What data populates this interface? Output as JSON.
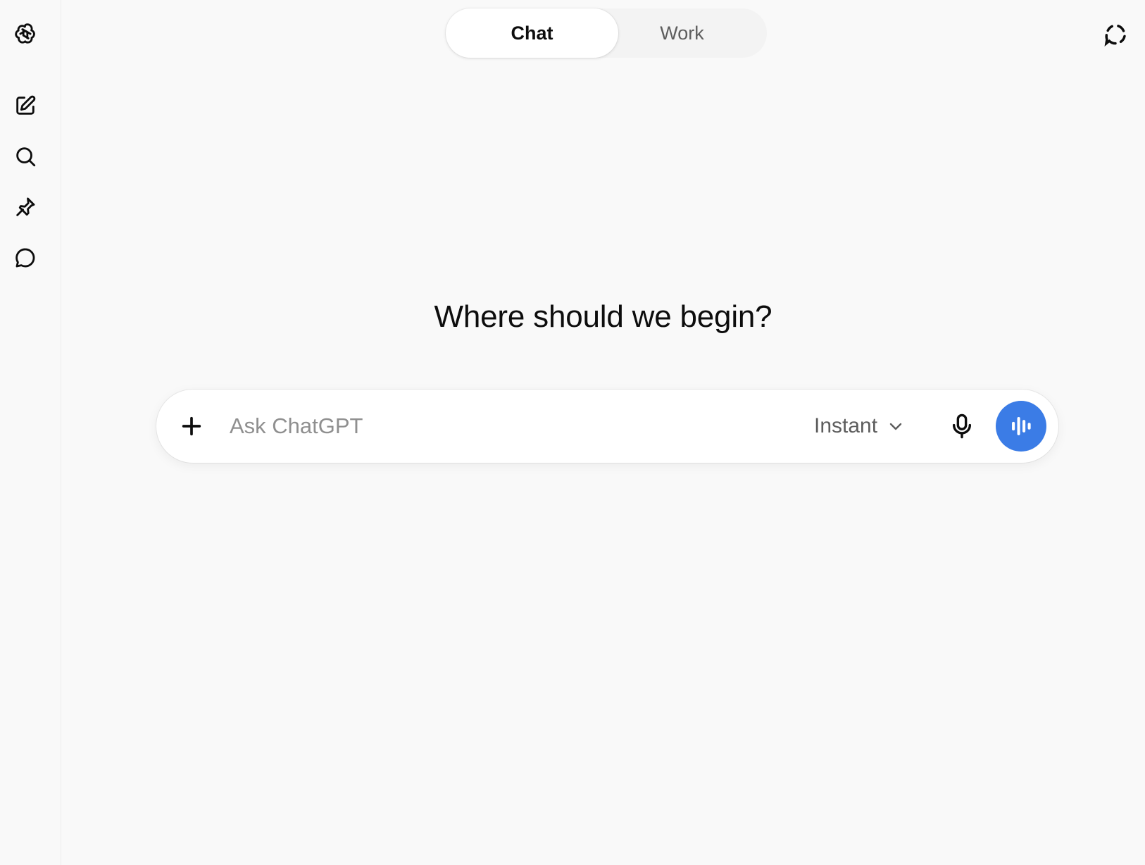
{
  "sidebar": {
    "items": [
      {
        "icon": "openai-logo-icon"
      },
      {
        "icon": "new-chat-icon"
      },
      {
        "icon": "search-icon"
      },
      {
        "icon": "pin-icon"
      },
      {
        "icon": "chat-bubble-icon"
      }
    ]
  },
  "mode_toggle": {
    "options": [
      {
        "label": "Chat",
        "selected": true
      },
      {
        "label": "Work",
        "selected": false
      }
    ]
  },
  "header": {
    "right_icon": "temporary-chat-icon"
  },
  "main": {
    "heading": "Where should we begin?"
  },
  "composer": {
    "placeholder": "Ask ChatGPT",
    "value": "",
    "model_label": "Instant",
    "icons": [
      "plus-icon",
      "chevron-down-icon",
      "microphone-icon",
      "voice-waveform-icon"
    ]
  },
  "colors": {
    "background": "#f9f9f9",
    "voice_button": "#3b7ce6",
    "text_primary": "#0d0d0d",
    "text_secondary": "#5d5d5d"
  }
}
